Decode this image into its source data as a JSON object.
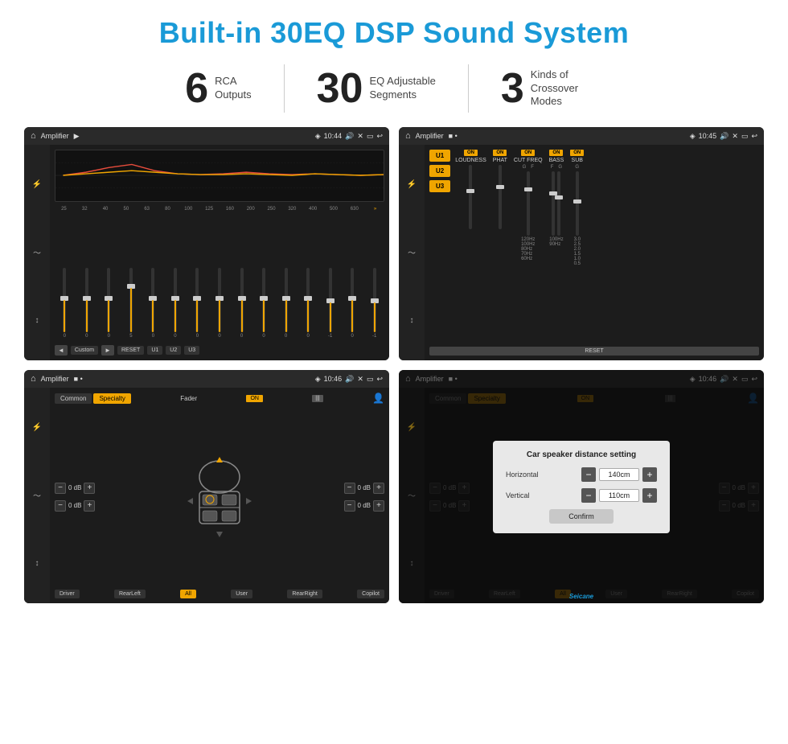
{
  "header": {
    "title": "Built-in 30EQ DSP Sound System"
  },
  "stats": [
    {
      "number": "6",
      "label": "RCA\nOutputs"
    },
    {
      "number": "30",
      "label": "EQ Adjustable\nSegments"
    },
    {
      "number": "3",
      "label": "Kinds of\nCrossover Modes"
    }
  ],
  "screens": [
    {
      "id": "screen1",
      "status": {
        "app": "Amplifier",
        "time": "10:44"
      },
      "type": "eq"
    },
    {
      "id": "screen2",
      "status": {
        "app": "Amplifier",
        "time": "10:45"
      },
      "type": "amplifier"
    },
    {
      "id": "screen3",
      "status": {
        "app": "Amplifier",
        "time": "10:46"
      },
      "type": "fader"
    },
    {
      "id": "screen4",
      "status": {
        "app": "Amplifier",
        "time": "10:46"
      },
      "type": "dialog"
    }
  ],
  "eq": {
    "freqs": [
      "25",
      "32",
      "40",
      "50",
      "63",
      "80",
      "100",
      "125",
      "160",
      "200",
      "250",
      "320",
      "400",
      "500",
      "630"
    ],
    "values": [
      "0",
      "0",
      "0",
      "5",
      "0",
      "0",
      "0",
      "0",
      "0",
      "0",
      "0",
      "0",
      "-1",
      "0",
      "-1"
    ],
    "buttons": [
      "Custom",
      "RESET",
      "U1",
      "U2",
      "U3"
    ]
  },
  "amplifier": {
    "presets": [
      "U1",
      "U2",
      "U3"
    ],
    "controls": [
      "LOUDNESS",
      "PHAT",
      "CUT FREQ",
      "BASS",
      "SUB"
    ],
    "resetLabel": "RESET"
  },
  "fader": {
    "tabs": [
      "Common",
      "Specialty"
    ],
    "faderLabel": "Fader",
    "onLabel": "ON",
    "locations": [
      "Driver",
      "RearLeft",
      "All",
      "User",
      "RearRight",
      "Copilot"
    ],
    "dbValues": [
      "0 dB",
      "0 dB",
      "0 dB",
      "0 dB"
    ]
  },
  "dialog": {
    "title": "Car speaker distance setting",
    "fields": [
      {
        "label": "Horizontal",
        "value": "140cm"
      },
      {
        "label": "Vertical",
        "value": "110cm"
      }
    ],
    "confirmLabel": "Confirm"
  },
  "watermark": "Seicane"
}
